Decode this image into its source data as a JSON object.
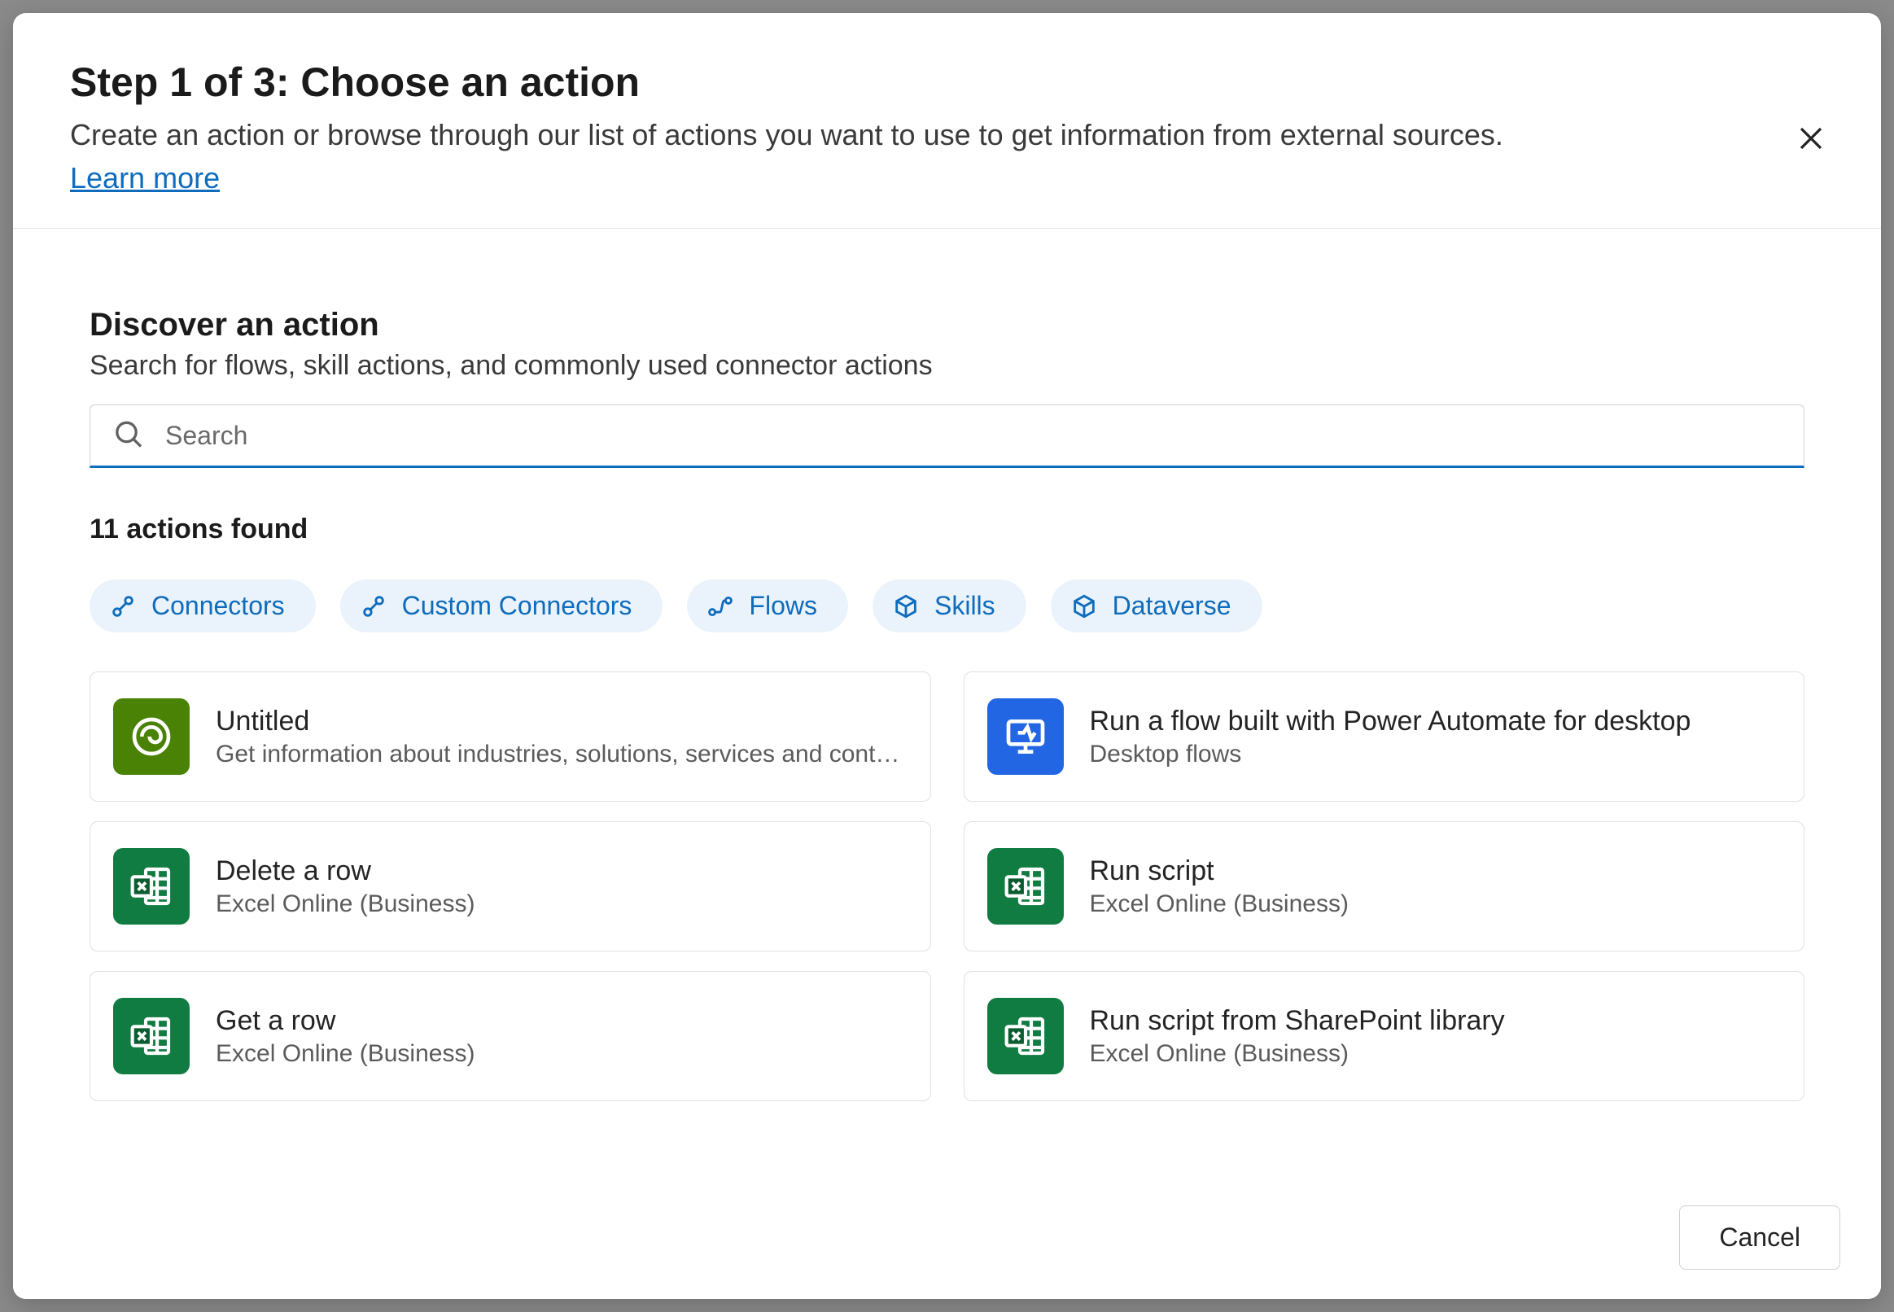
{
  "header": {
    "title": "Step 1 of 3: Choose an action",
    "subtitle": "Create an action or browse through our list of actions you want to use to get information from external sources.",
    "learn_more": "Learn more"
  },
  "discover": {
    "title": "Discover an action",
    "subtitle": "Search for flows, skill actions, and commonly used connector actions"
  },
  "search": {
    "placeholder": "Search",
    "value": ""
  },
  "results_label": "11 actions found",
  "filters": [
    {
      "id": "connectors",
      "label": "Connectors",
      "icon": "connector-icon"
    },
    {
      "id": "custom-connectors",
      "label": "Custom Connectors",
      "icon": "connector-icon"
    },
    {
      "id": "flows",
      "label": "Flows",
      "icon": "flow-icon"
    },
    {
      "id": "skills",
      "label": "Skills",
      "icon": "cube-icon"
    },
    {
      "id": "dataverse",
      "label": "Dataverse",
      "icon": "cube-icon"
    }
  ],
  "actions": [
    {
      "title": "Untitled",
      "subtitle": "Get information about industries, solutions, services and cont…",
      "icon": "olive",
      "icon_name": "swirl-icon"
    },
    {
      "title": "Run a flow built with Power Automate for desktop",
      "subtitle": "Desktop flows",
      "icon": "blue",
      "icon_name": "desktop-flow-icon"
    },
    {
      "title": "Delete a row",
      "subtitle": "Excel Online (Business)",
      "icon": "green",
      "icon_name": "excel-icon"
    },
    {
      "title": "Run script",
      "subtitle": "Excel Online (Business)",
      "icon": "green",
      "icon_name": "excel-icon"
    },
    {
      "title": "Get a row",
      "subtitle": "Excel Online (Business)",
      "icon": "green",
      "icon_name": "excel-icon"
    },
    {
      "title": "Run script from SharePoint library",
      "subtitle": "Excel Online (Business)",
      "icon": "green",
      "icon_name": "excel-icon"
    }
  ],
  "footer": {
    "cancel": "Cancel"
  },
  "colors": {
    "accent": "#0f6cbd",
    "chip_bg": "#eaf3fb",
    "excel_green": "#107c41",
    "flow_blue": "#2266e3",
    "olive": "#498205"
  }
}
